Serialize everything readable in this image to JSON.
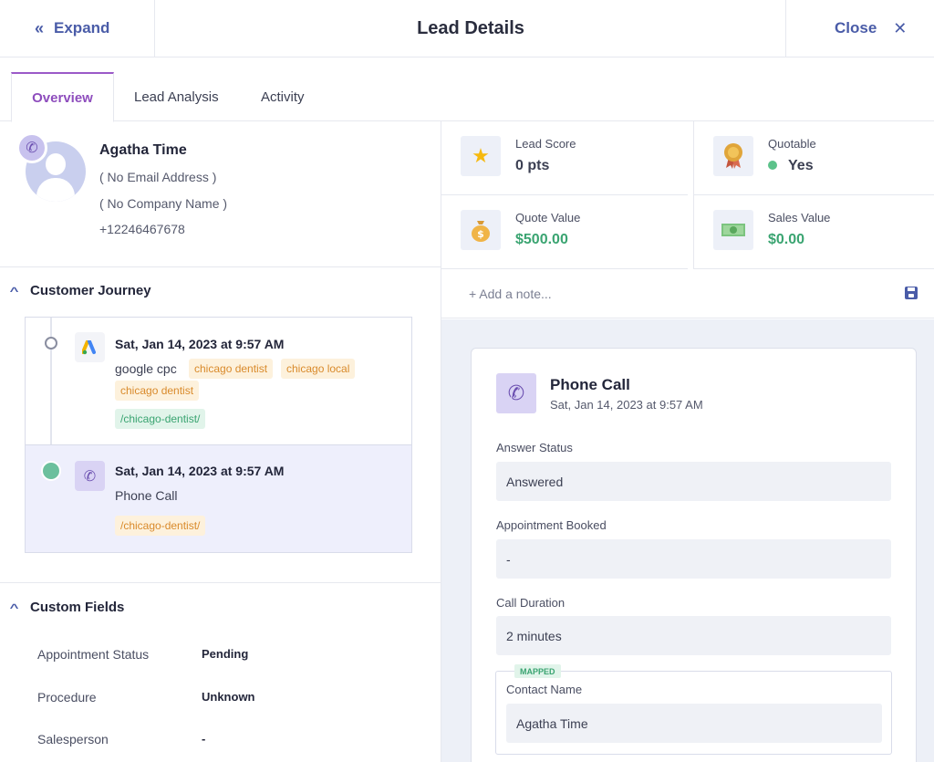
{
  "header": {
    "expand_label": "Expand",
    "title": "Lead Details",
    "close_label": "Close"
  },
  "tabs": [
    {
      "label": "Overview",
      "active": true
    },
    {
      "label": "Lead Analysis",
      "active": false
    },
    {
      "label": "Activity",
      "active": false
    }
  ],
  "contact": {
    "name": "Agatha Time",
    "email": "( No Email Address )",
    "company": "( No Company Name )",
    "phone": "+12246467678"
  },
  "journey": {
    "title": "Customer Journey",
    "items": [
      {
        "date": "Sat, Jan 14, 2023 at 9:57 AM",
        "source": "google cpc",
        "icon": "google-ads-icon",
        "tags": [
          "chicago dentist",
          "chicago local",
          "chicago dentist"
        ],
        "path": "/chicago-dentist/"
      },
      {
        "date": "Sat, Jan 14, 2023 at 9:57 AM",
        "source": "Phone Call",
        "icon": "phone-icon",
        "path": "/chicago-dentist/"
      }
    ]
  },
  "custom_fields": {
    "title": "Custom Fields",
    "rows": [
      {
        "label": "Appointment Status",
        "value": "Pending"
      },
      {
        "label": "Procedure",
        "value": "Unknown"
      },
      {
        "label": "Salesperson",
        "value": "-"
      }
    ]
  },
  "stats": {
    "lead_score": {
      "label": "Lead Score",
      "value": "0 pts",
      "icon": "star-icon"
    },
    "quotable": {
      "label": "Quotable",
      "value": "Yes",
      "icon": "award-icon"
    },
    "quote_value": {
      "label": "Quote Value",
      "value": "$500.00",
      "icon": "money-bag-icon"
    },
    "sales_value": {
      "label": "Sales Value",
      "value": "$0.00",
      "icon": "cash-icon"
    }
  },
  "note": {
    "placeholder": "+ Add a note..."
  },
  "detail": {
    "title": "Phone Call",
    "subtitle": "Sat, Jan 14, 2023 at 9:57 AM",
    "fields": [
      {
        "label": "Answer Status",
        "value": "Answered"
      },
      {
        "label": "Appointment Booked",
        "value": "-"
      },
      {
        "label": "Call Duration",
        "value": "2 minutes"
      }
    ],
    "mapped": {
      "badge": "MAPPED",
      "label": "Contact Name",
      "value": "Agatha Time"
    }
  },
  "colors": {
    "accent": "#4a5ca8",
    "tab_active": "#8e4dbd",
    "green": "#3aa471",
    "tag_orange": "#d98a2b"
  }
}
